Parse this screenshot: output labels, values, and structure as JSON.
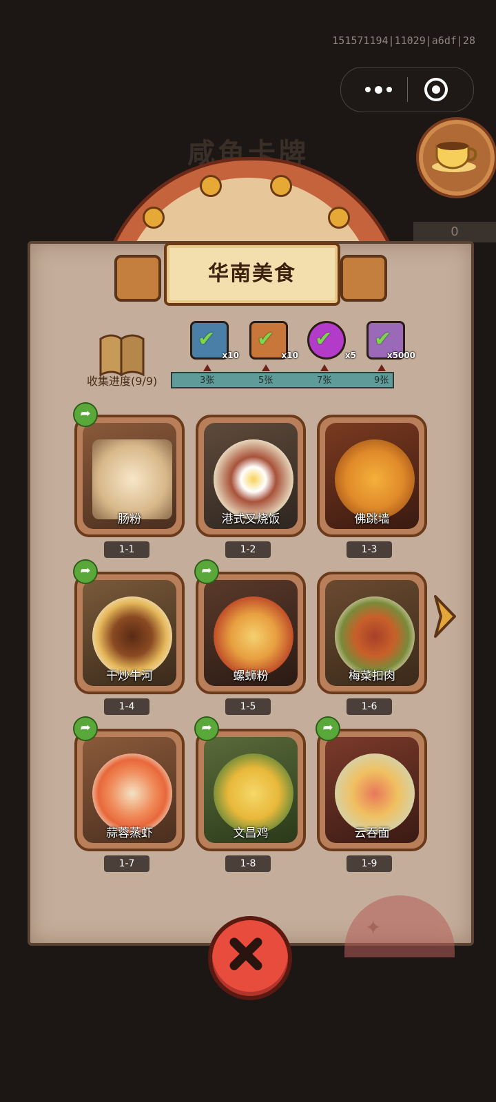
{
  "background": {
    "title": "咸鱼卡牌"
  },
  "debug_info": "151571194|11029|a6df|28",
  "side": {
    "counter": "0"
  },
  "panel": {
    "title": "华南美食",
    "progress_label": "收集进度(9/9)",
    "milestones": [
      {
        "label": "3张",
        "reward_qty": "x10",
        "reward_icon": "ticket-icon",
        "color": "#4a7fa8",
        "claimed": true
      },
      {
        "label": "5张",
        "reward_qty": "x10",
        "reward_icon": "scroll-icon",
        "color": "#c9763a",
        "claimed": true
      },
      {
        "label": "7张",
        "reward_qty": "x5",
        "reward_icon": "orb-icon",
        "color": "#b23cc9",
        "claimed": true
      },
      {
        "label": "9张",
        "reward_qty": "x5000",
        "reward_icon": "crystal-icon",
        "color": "#9a6ab8",
        "claimed": true
      }
    ],
    "progress": 1.0,
    "cards": [
      {
        "name": "肠粉",
        "id": "1-1",
        "shared": true
      },
      {
        "name": "港式叉烧饭",
        "id": "1-2",
        "shared": false
      },
      {
        "name": "佛跳墙",
        "id": "1-3",
        "shared": false
      },
      {
        "name": "干炒牛河",
        "id": "1-4",
        "shared": true
      },
      {
        "name": "螺蛳粉",
        "id": "1-5",
        "shared": true
      },
      {
        "name": "梅菜扣肉",
        "id": "1-6",
        "shared": false
      },
      {
        "name": "蒜蓉蒸虾",
        "id": "1-7",
        "shared": true
      },
      {
        "name": "文昌鸡",
        "id": "1-8",
        "shared": true
      },
      {
        "name": "云吞面",
        "id": "1-9",
        "shared": true
      }
    ]
  },
  "colors": {
    "accent": "#e74c3c",
    "parchment": "#c4ad9a",
    "progress": "#5f9c99"
  }
}
